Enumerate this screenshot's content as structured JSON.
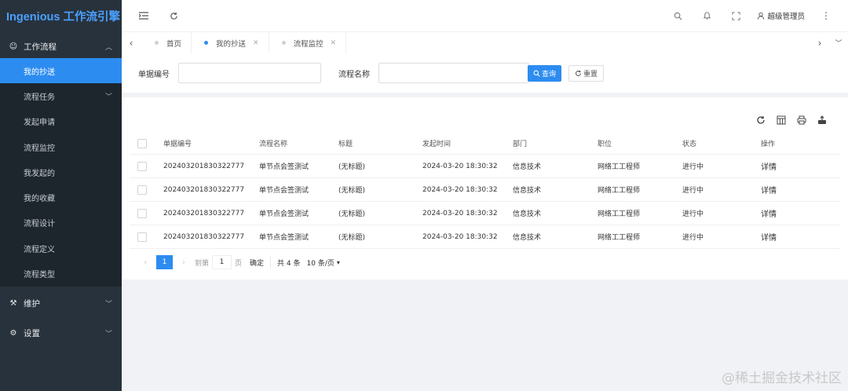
{
  "app": {
    "title": "Ingenious 工作流引擎"
  },
  "sidebar": {
    "group_workflow": {
      "label": "工作流程"
    },
    "items": [
      {
        "label": "我的抄送",
        "active": true
      },
      {
        "label": "流程任务",
        "has_children": true
      },
      {
        "label": "发起申请"
      },
      {
        "label": "流程监控"
      },
      {
        "label": "我发起的"
      },
      {
        "label": "我的收藏"
      },
      {
        "label": "流程设计"
      },
      {
        "label": "流程定义"
      },
      {
        "label": "流程类型"
      }
    ],
    "group_maintain": {
      "label": "维护"
    },
    "group_settings": {
      "label": "设置"
    }
  },
  "header": {
    "user_name": "超级管理员"
  },
  "tabs": [
    {
      "label": "首页",
      "closable": false
    },
    {
      "label": "我的抄送",
      "closable": true,
      "active": true
    },
    {
      "label": "流程监控",
      "closable": true
    }
  ],
  "search": {
    "doc_no_label": "单据编号",
    "doc_no_value": "",
    "process_name_label": "流程名称",
    "process_name_value": "",
    "query_button": "查询",
    "reset_button": "重置"
  },
  "table": {
    "columns": [
      "单据编号",
      "流程名称",
      "标题",
      "发起时间",
      "部门",
      "职位",
      "状态",
      "操作"
    ],
    "rows": [
      {
        "doc_no": "202403201830322777",
        "process": "单节点会签测试",
        "title": "(无标题)",
        "time": "2024-03-20 18:30:32",
        "dept": "信息技术",
        "position": "网络工工程师",
        "status": "进行中",
        "action": "详情"
      },
      {
        "doc_no": "202403201830322777",
        "process": "单节点会签测试",
        "title": "(无标题)",
        "time": "2024-03-20 18:30:32",
        "dept": "信息技术",
        "position": "网络工工程师",
        "status": "进行中",
        "action": "详情"
      },
      {
        "doc_no": "202403201830322777",
        "process": "单节点会签测试",
        "title": "(无标题)",
        "time": "2024-03-20 18:30:32",
        "dept": "信息技术",
        "position": "网络工工程师",
        "status": "进行中",
        "action": "详情"
      },
      {
        "doc_no": "202403201830322777",
        "process": "单节点会签测试",
        "title": "(无标题)",
        "time": "2024-03-20 18:30:32",
        "dept": "信息技术",
        "position": "网络工工程师",
        "status": "进行中",
        "action": "详情"
      }
    ]
  },
  "pager": {
    "current_page": "1",
    "goto_prefix": "到第",
    "goto_value": "1",
    "goto_suffix": "页",
    "confirm": "确定",
    "total": "共 4 条",
    "page_size": "10 条/页"
  },
  "watermark": "@稀土掘金技术社区",
  "colors": {
    "primary": "#2d8cf0",
    "sidebar_bg": "#28323c",
    "submenu_bg": "#1d252d",
    "logo": "#4aa0ff"
  }
}
